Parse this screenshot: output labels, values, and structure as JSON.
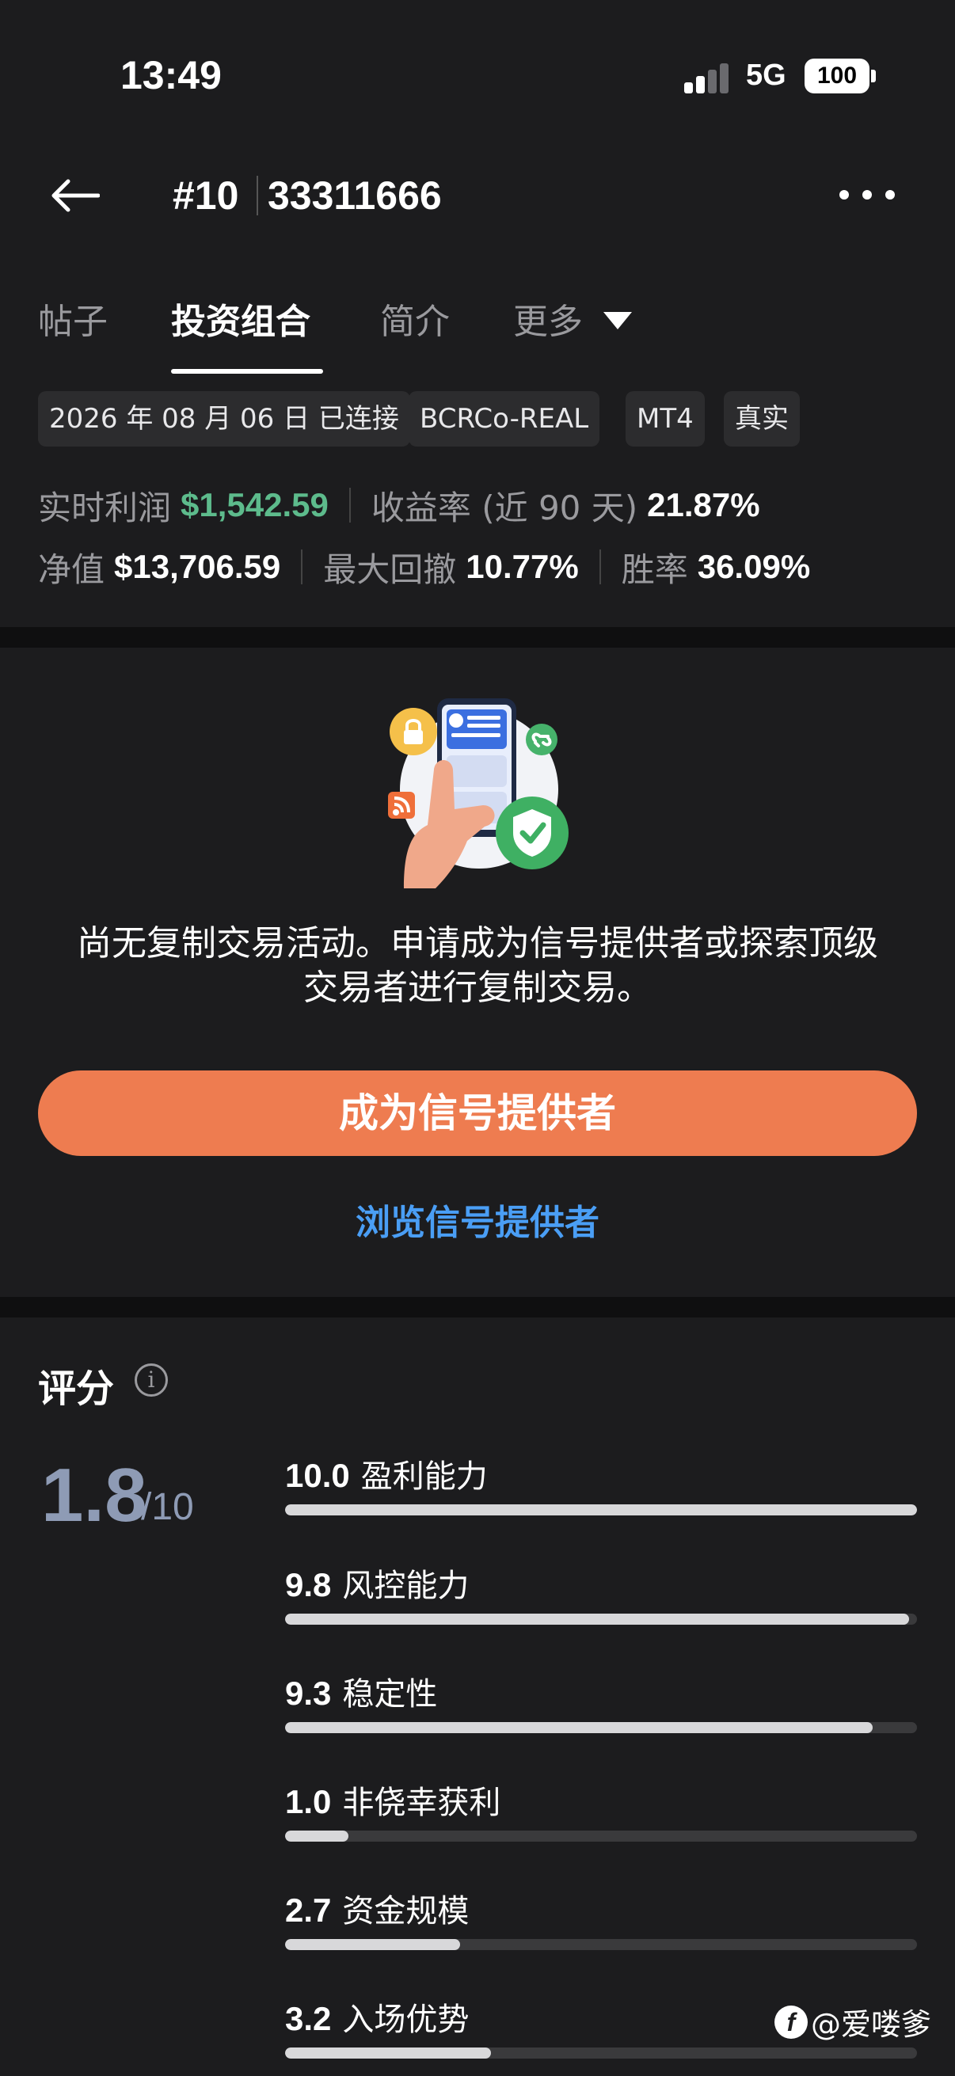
{
  "status_bar": {
    "time": "13:49",
    "network": "5G",
    "battery": "100"
  },
  "header": {
    "number": "#10",
    "account_id": "33311666"
  },
  "tabs": [
    {
      "label": "帖子"
    },
    {
      "label": "投资组合",
      "active": true
    },
    {
      "label": "简介"
    },
    {
      "label": "更多"
    }
  ],
  "chips": [
    "2026 年 08 月 06 日 已连接",
    "BCRCo-REAL",
    "MT4",
    "真实"
  ],
  "stats": {
    "realtime_profit_label": "实时利润",
    "realtime_profit_value": "$1,542.59",
    "return_label": "收益率 (近 90 天)",
    "return_value": "21.87%",
    "equity_label": "净值",
    "equity_value": "$13,706.59",
    "drawdown_label": "最大回撤",
    "drawdown_value": "10.77%",
    "winrate_label": "胜率",
    "winrate_value": "36.09%"
  },
  "empty_state": {
    "message_line1": "尚无复制交易活动。申请成为信号提供者或探索顶级",
    "message_line2": "交易者进行复制交易。",
    "primary_button": "成为信号提供者",
    "link": "浏览信号提供者"
  },
  "score": {
    "title": "评分",
    "value": "1.8",
    "max": "/10",
    "metrics": [
      {
        "score": "10.0",
        "label": "盈利能力",
        "fraction": 1.0
      },
      {
        "score": "9.8",
        "label": "风控能力",
        "fraction": 0.988
      },
      {
        "score": "9.3",
        "label": "稳定性",
        "fraction": 0.93
      },
      {
        "score": "1.0",
        "label": "非侥幸获利",
        "fraction": 0.1
      },
      {
        "score": "2.7",
        "label": "资金规模",
        "fraction": 0.277
      },
      {
        "score": "3.2",
        "label": "入场优势",
        "fraction": 0.326
      }
    ]
  },
  "watermark": "@爱喽爹",
  "colors": {
    "accent": "#ee7c50",
    "link": "#4a9ef5",
    "profit": "#5dbb8c",
    "score": "#8e9bb5"
  }
}
